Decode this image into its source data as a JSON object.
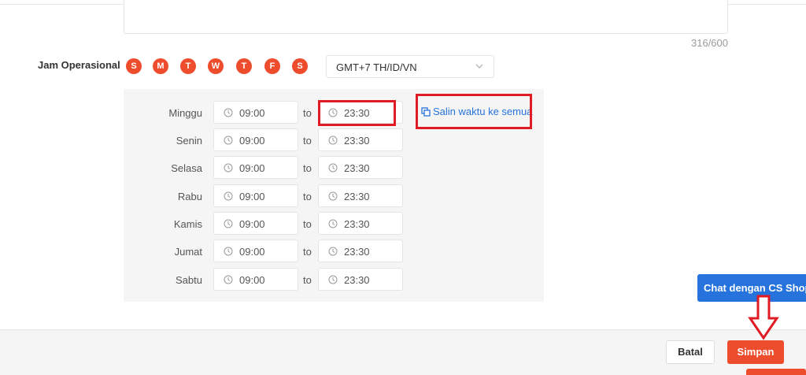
{
  "description": {
    "char_count": "316/600"
  },
  "operating_hours": {
    "label": "Jam Operasional",
    "day_pills": [
      "S",
      "M",
      "T",
      "W",
      "T",
      "F",
      "S"
    ],
    "timezone": "GMT+7 TH/ID/VN",
    "connector": "to",
    "copy_link_label": "Salin waktu ke semua",
    "schedule": [
      {
        "day": "Minggu",
        "start": "09:00",
        "end": "23:30"
      },
      {
        "day": "Senin",
        "start": "09:00",
        "end": "23:30"
      },
      {
        "day": "Selasa",
        "start": "09:00",
        "end": "23:30"
      },
      {
        "day": "Rabu",
        "start": "09:00",
        "end": "23:30"
      },
      {
        "day": "Kamis",
        "start": "09:00",
        "end": "23:30"
      },
      {
        "day": "Jumat",
        "start": "09:00",
        "end": "23:30"
      },
      {
        "day": "Sabtu",
        "start": "09:00",
        "end": "23:30"
      }
    ]
  },
  "chat": {
    "label": "Chat dengan CS Shopee"
  },
  "footer": {
    "cancel_label": "Batal",
    "save_label": "Simpan"
  },
  "colors": {
    "brand": "#ee4d2d",
    "link": "#2673dd",
    "annotation": "#e01b24"
  }
}
